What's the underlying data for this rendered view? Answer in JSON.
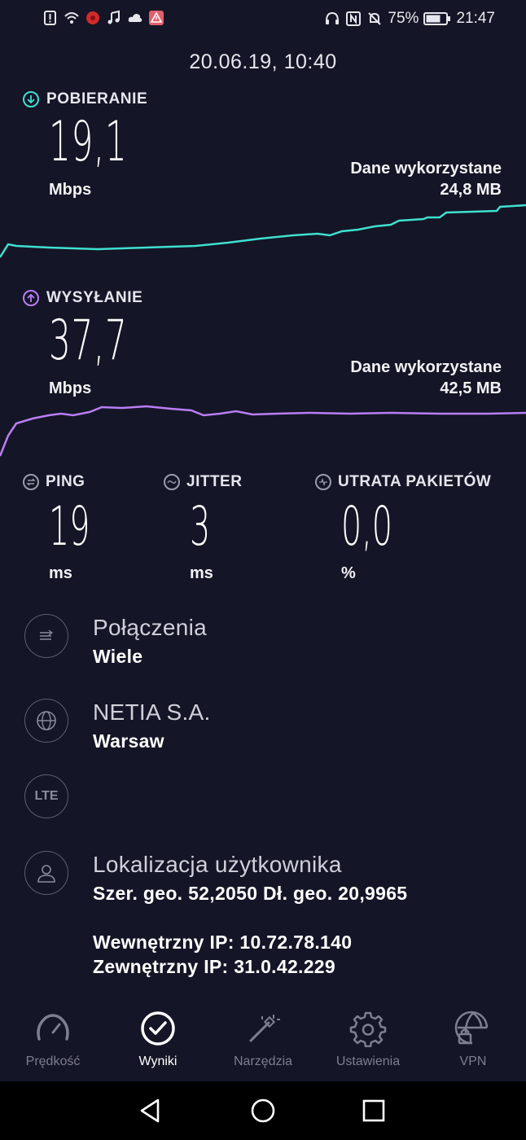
{
  "status_bar": {
    "battery": "75%",
    "time": "21:47"
  },
  "result": {
    "timestamp": "20.06.19, 10:40"
  },
  "download": {
    "label": "POBIERANIE",
    "value": "19,1",
    "unit": "Mbps",
    "data_used_label": "Dane wykorzystane",
    "data_used_value": "24,8 MB",
    "color": "#3fe0d0"
  },
  "upload": {
    "label": "WYSYŁANIE",
    "value": "37,7",
    "unit": "Mbps",
    "data_used_label": "Dane wykorzystane",
    "data_used_value": "42,5 MB",
    "color": "#b97ef5"
  },
  "ping": {
    "label": "PING",
    "value": "19",
    "unit": "ms"
  },
  "jitter": {
    "label": "JITTER",
    "value": "3",
    "unit": "ms"
  },
  "packet_loss": {
    "label": "UTRATA PAKIETÓW",
    "value": "0,0",
    "unit": "%"
  },
  "connections": {
    "title": "Połączenia",
    "value": "Wiele"
  },
  "provider": {
    "title": "NETIA S.A.",
    "value": "Warsaw"
  },
  "network_type": {
    "badge": "LTE"
  },
  "location": {
    "title": "Lokalizacja użytkownika",
    "coords": "Szer. geo. 52,2050 Dł. geo. 20,9965",
    "internal_ip": "Wewnętrzny IP: 10.72.78.140",
    "external_ip": "Zewnętrzny IP: 31.0.42.229"
  },
  "nav": {
    "items": [
      {
        "label": "Prędkość",
        "icon": "speedometer-icon"
      },
      {
        "label": "Wyniki",
        "icon": "check-circle-icon"
      },
      {
        "label": "Narzędzia",
        "icon": "magic-wand-icon"
      },
      {
        "label": "Ustawienia",
        "icon": "gear-icon"
      },
      {
        "label": "VPN",
        "icon": "globe-lock-icon"
      }
    ],
    "active_index": 1
  }
}
